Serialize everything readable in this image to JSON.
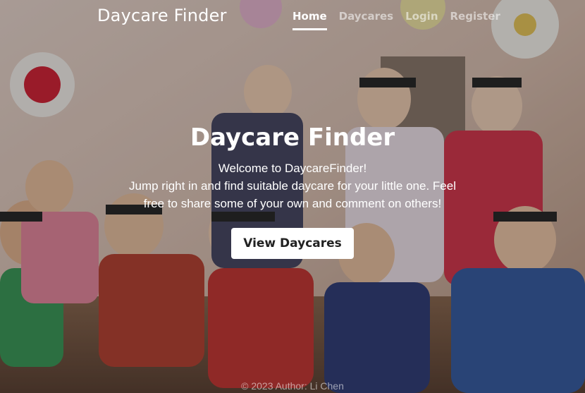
{
  "navbar": {
    "brand": "Daycare Finder",
    "links": [
      {
        "label": "Home",
        "active": true
      },
      {
        "label": "Daycares",
        "active": false
      },
      {
        "label": "Login",
        "active": false
      },
      {
        "label": "Register",
        "active": false
      }
    ]
  },
  "hero": {
    "title": "Daycare Finder",
    "welcome": "Welcome to DaycareFinder!",
    "lead": "Jump right in and find suitable daycare for your little one. Feel free to share some of your own and comment on others!",
    "cta_label": "View Daycares",
    "background": "photo-children-group"
  },
  "footer": {
    "text": "© 2023 Author: Li Chen"
  },
  "colors": {
    "overlay": "#000000",
    "text": "#ffffff",
    "nav_muted": "#ffffff8c",
    "button_bg": "#ffffff",
    "button_text": "#222222"
  }
}
